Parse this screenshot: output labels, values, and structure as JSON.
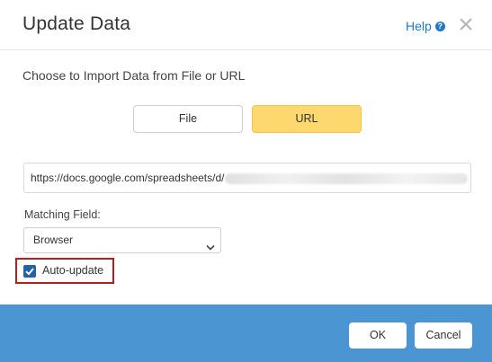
{
  "dialog": {
    "title": "Update Data",
    "help_label": "Help",
    "help_icon": "question-circle-icon",
    "close_icon": "close-icon"
  },
  "import": {
    "prompt": "Choose to Import Data from File or URL",
    "options": [
      "File",
      "URL"
    ],
    "selected": "URL",
    "accent_color": "#fcd86f"
  },
  "url_field": {
    "value_visible": "https://docs.google.com/spreadsheets/d/"
  },
  "matching": {
    "label": "Matching Field:",
    "selected": "Browser"
  },
  "auto_update": {
    "label": "Auto-update",
    "checked": true
  },
  "footer": {
    "ok_label": "OK",
    "cancel_label": "Cancel",
    "background_color": "#4b96d2"
  }
}
